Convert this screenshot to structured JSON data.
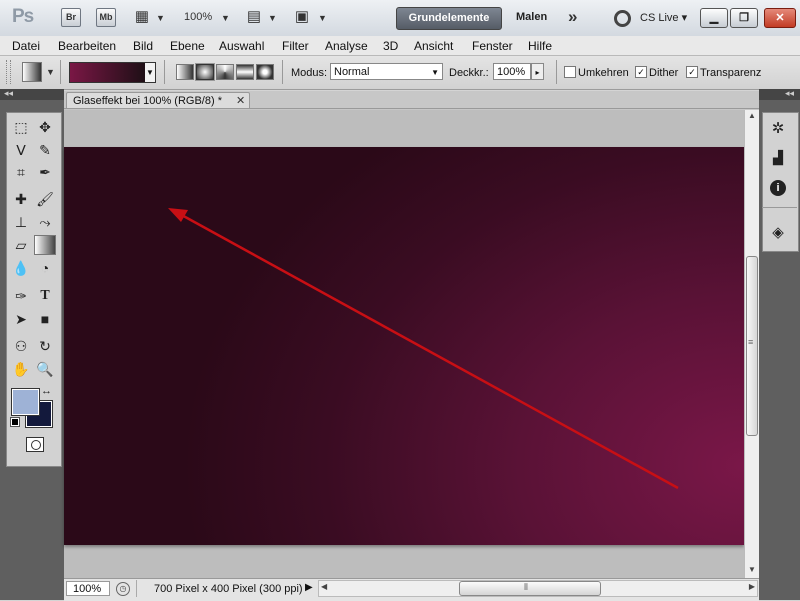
{
  "titlebar": {
    "logo": "Ps",
    "br_label": "Br",
    "mb_label": "Mb",
    "zoom": "100%",
    "workspace_active": "Grundelemente",
    "workspace_other": "Malen",
    "more": "»",
    "cs_live": "CS Live"
  },
  "menubar": [
    "Datei",
    "Bearbeiten",
    "Bild",
    "Ebene",
    "Auswahl",
    "Filter",
    "Analyse",
    "3D",
    "Ansicht",
    "Fenster",
    "Hilfe"
  ],
  "options": {
    "mode_label": "Modus:",
    "mode_value": "Normal",
    "opacity_label": "Deckkr.:",
    "opacity_value": "100%",
    "reverse_label": "Umkehren",
    "reverse_checked": false,
    "dither_label": "Dither",
    "dither_checked": true,
    "transparency_label": "Transparenz",
    "transparency_checked": true,
    "gradient_start_color": "#7a1745",
    "gradient_end_color": "#1d0f15"
  },
  "document": {
    "tab_title": "Glaseffekt bei 100% (RGB/8) *",
    "zoom": "100%",
    "status": "700 Pixel x 400 Pixel (300 ppi)"
  },
  "colors": {
    "foreground": "#9eb2d6",
    "background": "#13193c",
    "arrow": "#c80f14"
  }
}
